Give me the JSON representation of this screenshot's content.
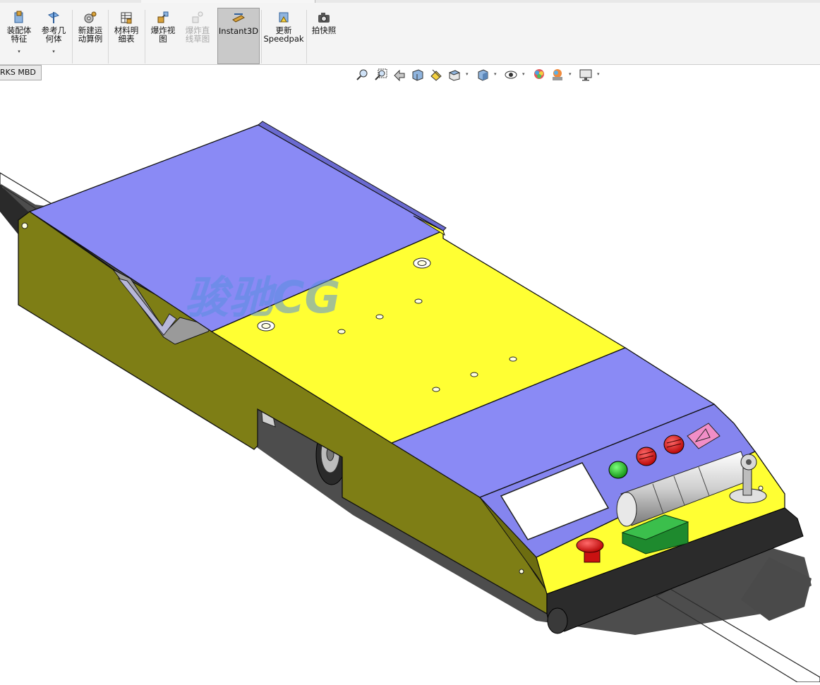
{
  "ribbon": {
    "buttons": [
      {
        "id": "assembly-feature",
        "label": "装配体\n特征",
        "icon": "assembly-feature-icon",
        "has_dropdown": true,
        "enabled": true
      },
      {
        "id": "reference-geometry",
        "label": "参考几\n何体",
        "icon": "reference-geometry-icon",
        "has_dropdown": true,
        "enabled": true
      },
      {
        "id": "new-motion-study",
        "label": "新建运\n动算例",
        "icon": "motion-study-icon",
        "enabled": true
      },
      {
        "id": "bill-of-materials",
        "label": "材料明\n细表",
        "icon": "bom-icon",
        "enabled": true
      },
      {
        "id": "exploded-view",
        "label": "爆炸视\n图",
        "icon": "exploded-view-icon",
        "enabled": true
      },
      {
        "id": "explode-line-sketch",
        "label": "爆炸直\n线草图",
        "icon": "explode-line-sketch-icon",
        "enabled": false
      },
      {
        "id": "instant3d",
        "label": "Instant3D",
        "icon": "instant3d-icon",
        "enabled": true,
        "active": true
      },
      {
        "id": "update-speedpak",
        "label": "更新\nSpeedpak",
        "icon": "speedpak-icon",
        "enabled": true
      },
      {
        "id": "take-snapshot",
        "label": "拍快照",
        "icon": "camera-icon",
        "enabled": true
      }
    ]
  },
  "tabs": {
    "mbd": "RKS MBD"
  },
  "view_toolbar": {
    "icons": [
      "zoom-to-fit-icon",
      "zoom-to-area-icon",
      "previous-view-icon",
      "section-view-icon",
      "dynamic-annotation-icon",
      "view-orientation-icon",
      "display-style-icon",
      "hide-show-icon",
      "edit-appearance-icon",
      "apply-scene-icon",
      "view-settings-icon"
    ]
  },
  "watermark": "骏驰CG",
  "colors": {
    "body_yellow": "#ffff33",
    "side_olive": "#7e7e15",
    "top_panel_blue": "#8a8af5",
    "front_panel_blue": "#8585ef",
    "bumper": "#2b2b2b",
    "watermark": "#5a8fe0",
    "ribbon_bg": "#f4f4f4"
  }
}
